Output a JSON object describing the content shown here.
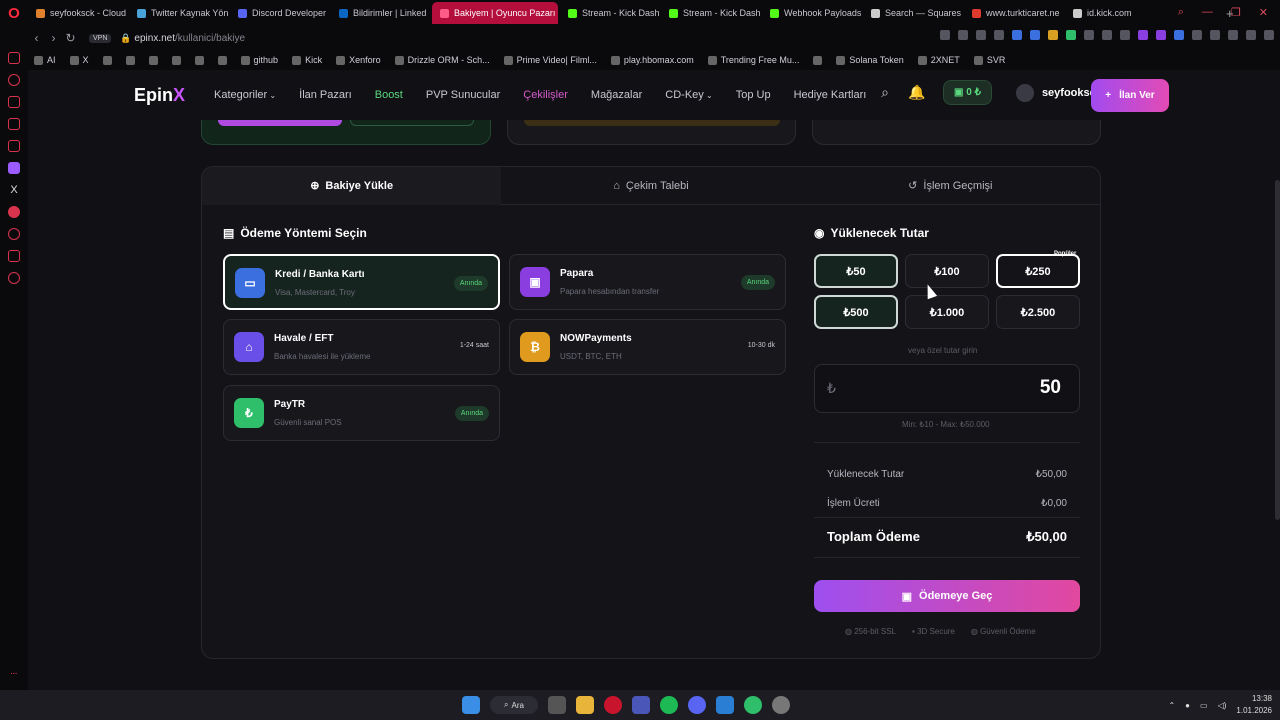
{
  "browser": {
    "tabs": [
      {
        "title": "seyfooksck - Cloud",
        "color": "#e0812e"
      },
      {
        "title": "Twitter Kaynak Yön",
        "color": "#4aa3d8"
      },
      {
        "title": "Discord Developer",
        "color": "#5865f2"
      },
      {
        "title": "Bildirimler | Linked",
        "color": "#0a66c2"
      },
      {
        "title": "Bakiyem | Oyuncu Pazarı",
        "color": "#ff5c8a",
        "active": true
      },
      {
        "title": "Stream - Kick Dash",
        "color": "#53fc18"
      },
      {
        "title": "Stream - Kick Dash",
        "color": "#53fc18"
      },
      {
        "title": "Webhook Payloads",
        "color": "#53fc18"
      },
      {
        "title": "Search — Squares",
        "color": "#cccccc"
      },
      {
        "title": "www.turkticaret.ne",
        "color": "#e0392e"
      },
      {
        "title": "id.kick.com",
        "color": "#cccccc"
      }
    ],
    "vpn": "VPN",
    "url_host": "epinx.net",
    "url_path": "/kullanici/bakiye",
    "bookmarks": [
      "AI",
      "X",
      "",
      "",
      "",
      "",
      "",
      "",
      "github",
      "Kick",
      "Xenforo",
      "Drizzle ORM - Sch...",
      "Prime Video| Filml...",
      "play.hbomax.com",
      "Trending Free Mu...",
      "",
      "Solana Token",
      "2XNET",
      "SVR"
    ]
  },
  "site": {
    "logo": "Epin",
    "logo_x": "X",
    "menu": [
      "Kategoriler",
      "İlan Pazarı",
      "Boost",
      "PVP Sunucular",
      "Çekilişler",
      "Mağazalar",
      "CD-Key",
      "Top Up",
      "Hediye Kartları"
    ],
    "balance": "0 ₺",
    "username": "seyfooksck",
    "ilan_button": "İlan Ver"
  },
  "panel": {
    "tabs": [
      "Bakiye Yükle",
      "Çekim Talebi",
      "İşlem Geçmişi"
    ],
    "method_title": "Ödeme Yöntemi Seçin",
    "methods": [
      {
        "name": "Kredi / Banka Kartı",
        "desc": "Visa, Mastercard, Troy",
        "badge": "Anında",
        "color": "#3b6fe0",
        "icon": "card-icon"
      },
      {
        "name": "Papara",
        "desc": "Papara hesabından transfer",
        "badge": "Anında",
        "color": "#8a3ee0",
        "icon": "wallet-icon"
      },
      {
        "name": "Havale / EFT",
        "desc": "Banka havalesi ile yükleme",
        "badge": "1-24 saat",
        "color": "#6a4ee8",
        "icon": "bank-icon"
      },
      {
        "name": "NOWPayments",
        "desc": "USDT, BTC, ETH",
        "badge": "10-30 dk",
        "color": "#e09a1e",
        "icon": "bitcoin-icon"
      },
      {
        "name": "PayTR",
        "desc": "Güvenli sanal POS",
        "badge": "Anında",
        "color": "#2fbf6a",
        "icon": "pos-icon"
      }
    ],
    "amount_title": "Yüklenecek Tutar",
    "amounts": [
      "₺50",
      "₺100",
      "₺250",
      "₺500",
      "₺1.000",
      "₺2.500"
    ],
    "popular": "Popüler",
    "custom_hint": "veya özel tutar girin",
    "currency_symbol": "₺",
    "amount_value": "50",
    "limits": "Min: ₺10 - Max: ₺50.000",
    "summary": {
      "load_label": "Yüklenecek Tutar",
      "load_value": "₺50,00",
      "fee_label": "İşlem Ücreti",
      "fee_value": "₺0,00",
      "total_label": "Toplam Ödeme",
      "total_value": "₺50,00"
    },
    "pay_button": "Ödemeye Geç",
    "security": [
      "256-bit SSL",
      "3D Secure",
      "Güvenli Ödeme"
    ]
  },
  "taskbar": {
    "search": "Ara",
    "time": "13:38",
    "date": "1.01.2026"
  },
  "colors": {
    "accent_purple": "#a24bf0",
    "accent_pink": "#e24bb5",
    "green": "#5ad67c"
  }
}
